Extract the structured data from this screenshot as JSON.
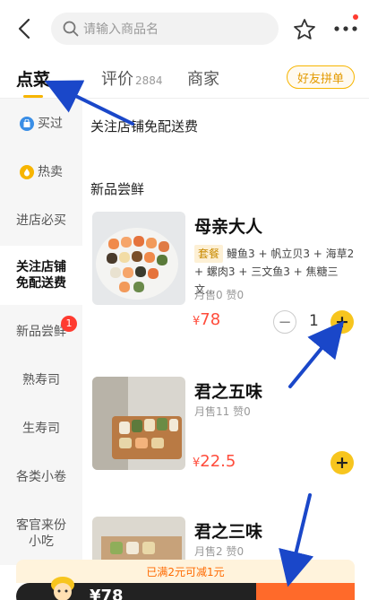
{
  "header": {
    "search_placeholder": "请输入商品名",
    "back_icon": "chevron-left-icon",
    "favorite_icon": "star-icon",
    "more_icon": "more-dots-icon"
  },
  "tabs": {
    "items": [
      {
        "label": "点菜",
        "active": true
      },
      {
        "label": "评价",
        "count": "2884"
      },
      {
        "label": "商家"
      }
    ],
    "group_order_label": "好友拼单"
  },
  "sidebar": {
    "items": [
      {
        "label": "买过",
        "icon": "bag-icon"
      },
      {
        "label": "热卖",
        "icon": "flame-icon"
      },
      {
        "label": "进店必买"
      },
      {
        "label": "关注店铺\n免配送费",
        "active": true
      },
      {
        "label": "新品尝鲜",
        "badge": "1"
      },
      {
        "label": "熟寿司"
      },
      {
        "label": "生寿司"
      },
      {
        "label": "各类小卷"
      },
      {
        "label": "客官来份\n小吃"
      }
    ]
  },
  "main": {
    "promo_section_title": "关注店铺免配送费",
    "new_section_title": "新品尝鲜",
    "products": [
      {
        "name": "母亲大人",
        "set_tag": "套餐",
        "contents": "鳗鱼3 + 帆立贝3 + 海草2 + 螺肉3 + 三文鱼3 + 焦糖三文...",
        "sales": "月售0",
        "likes": "赞0",
        "currency": "¥",
        "price": "78",
        "quantity": "1"
      },
      {
        "name": "君之五味",
        "sales": "月售11",
        "likes": "赞0",
        "currency": "¥",
        "price": "22.5"
      },
      {
        "name": "君之三味",
        "sales": "月售2",
        "likes": "赞0"
      }
    ]
  },
  "bottom": {
    "promo_text": "已满2元可减1元",
    "cart_price": "¥78"
  },
  "colors": {
    "accent": "#f7c51e",
    "price": "#ff4c3b",
    "annotation_arrow": "#1a47c9"
  }
}
